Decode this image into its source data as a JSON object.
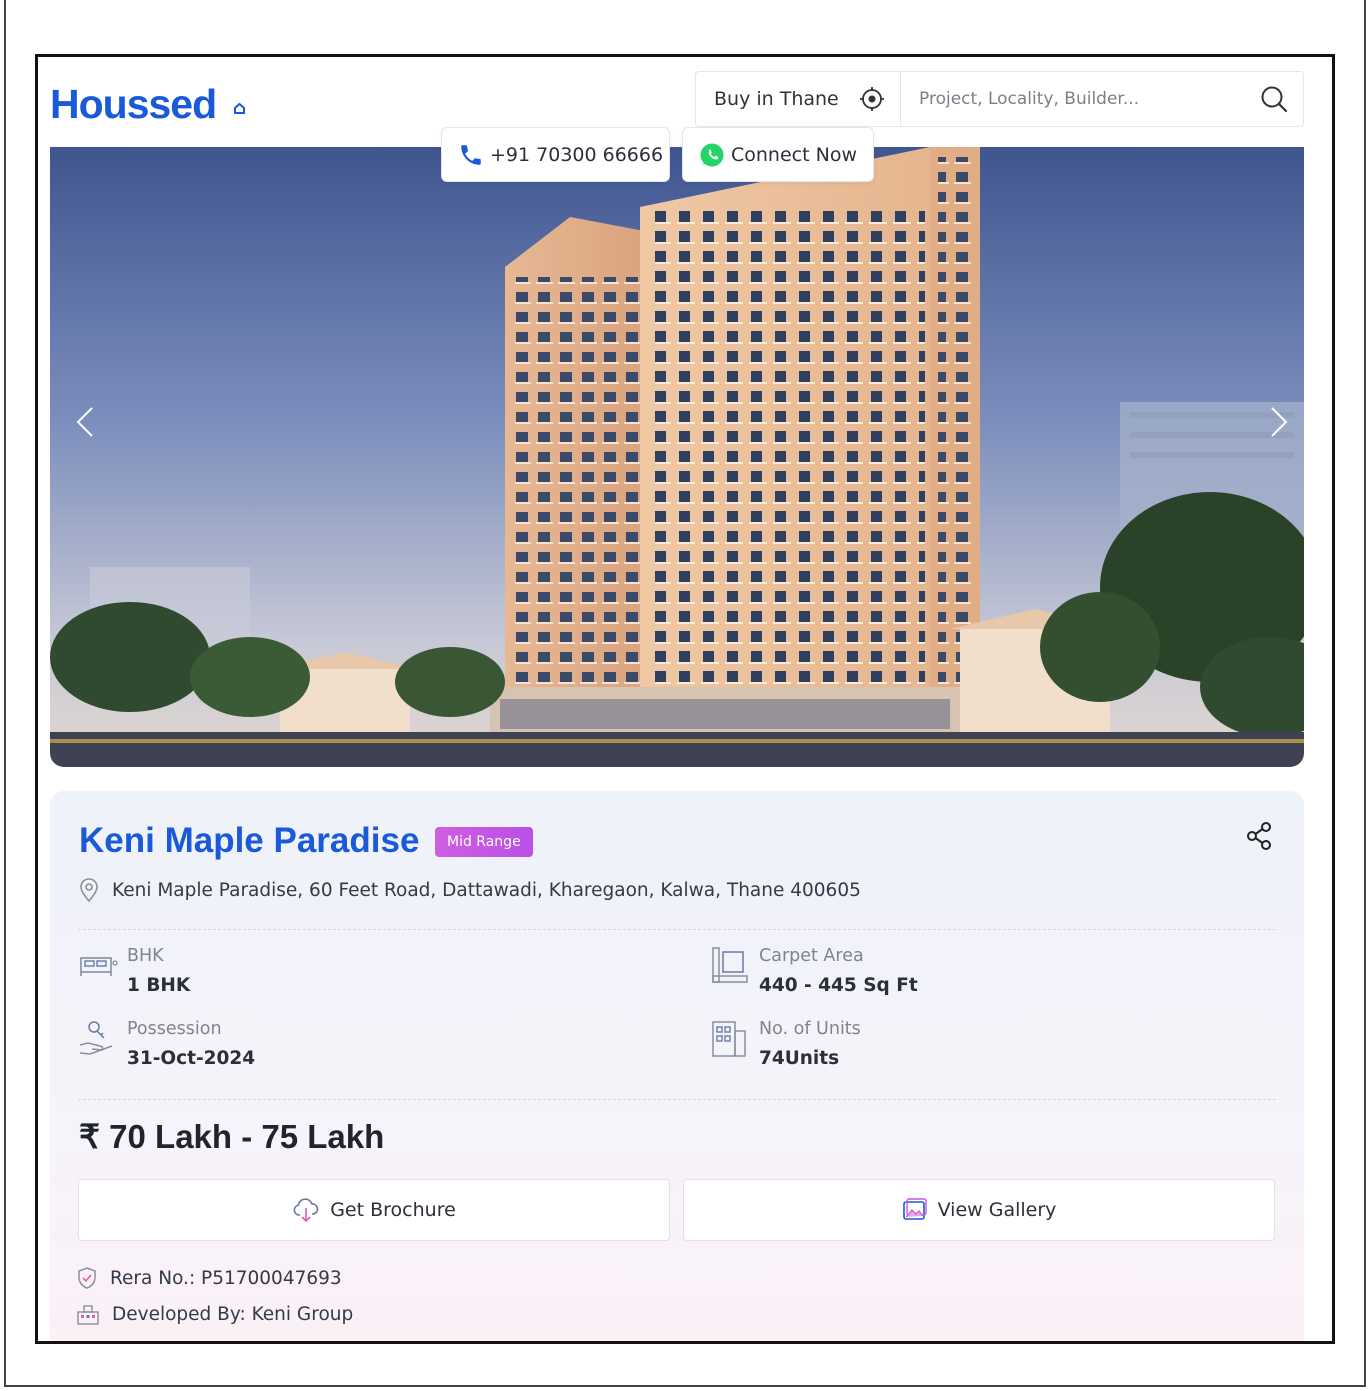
{
  "header": {
    "logo_text": "Houssed",
    "city_select": "Buy in Thane",
    "search_placeholder": "Project, Locality, Builder...",
    "phone": "+91 70300 66666",
    "connect": "Connect Now"
  },
  "project": {
    "name": "Keni Maple Paradise",
    "badge": "Mid Range",
    "address": "Keni Maple Paradise, 60 Feet Road, Dattawadi, Kharegaon, Kalwa, Thane 400605",
    "specs": {
      "bhk_label": "BHK",
      "bhk_value": "1 BHK",
      "carpet_label": "Carpet Area",
      "carpet_value": "440 - 445 Sq Ft",
      "possession_label": "Possession",
      "possession_value": "31-Oct-2024",
      "units_label": "No. of Units",
      "units_value": "74Units"
    },
    "price": "₹ 70 Lakh - 75 Lakh",
    "brochure_label": "Get Brochure",
    "gallery_label": "View Gallery",
    "rera": "Rera No.: P51700047693",
    "developer": "Developed By: Keni Group"
  },
  "colors": {
    "brand_blue": "#1a5ad8",
    "badge_purple": "#c257e4",
    "whatsapp_green": "#25d366"
  },
  "icons": [
    "locate-icon",
    "search-icon",
    "phone-icon",
    "whatsapp-icon",
    "chevron-left-icon",
    "chevron-right-icon",
    "share-icon",
    "location-pin-icon",
    "bed-icon",
    "area-icon",
    "possession-icon",
    "building-icon",
    "download-cloud-icon",
    "gallery-icon",
    "shield-check-icon",
    "developer-icon"
  ]
}
